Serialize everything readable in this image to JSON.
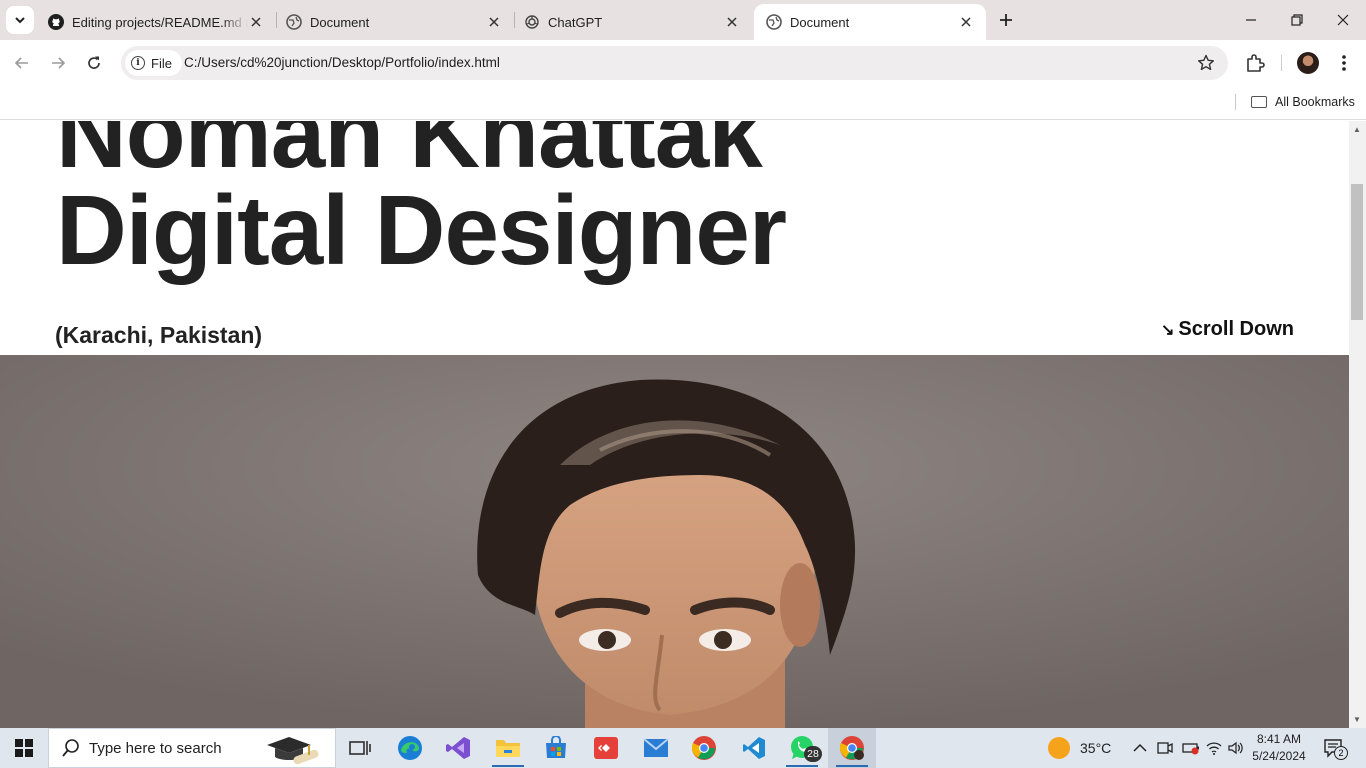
{
  "browser": {
    "tabs": [
      {
        "title": "Editing projects/README.md at",
        "icon": "github-icon",
        "active": false
      },
      {
        "title": "Document",
        "icon": "globe-icon",
        "active": false
      },
      {
        "title": "ChatGPT",
        "icon": "chatgpt-icon",
        "active": false
      },
      {
        "title": "Document",
        "icon": "globe-icon",
        "active": true
      }
    ],
    "address": {
      "chip_label": "File",
      "url": "C:/Users/cd%20junction/Desktop/Portfolio/index.html"
    },
    "bookmarks": {
      "all_bookmarks_label": "All Bookmarks"
    }
  },
  "page": {
    "name_line": "Noman Khattak",
    "role_line": "Digital Designer",
    "location": "(Karachi, Pakistan)",
    "scroll_label": "Scroll Down",
    "scroll_arrow": "↘"
  },
  "taskbar": {
    "search_placeholder": "Type here to search",
    "apps": [
      "task-view",
      "edge",
      "visual-studio",
      "file-explorer",
      "microsoft-store",
      "anydesk",
      "mail",
      "chrome",
      "vscode",
      "whatsapp",
      "chrome-profile"
    ],
    "whatsapp_badge": "28",
    "weather": {
      "temp": "35°C"
    },
    "clock": {
      "time": "8:41 AM",
      "date": "5/24/2024"
    },
    "notification_count": "2"
  }
}
